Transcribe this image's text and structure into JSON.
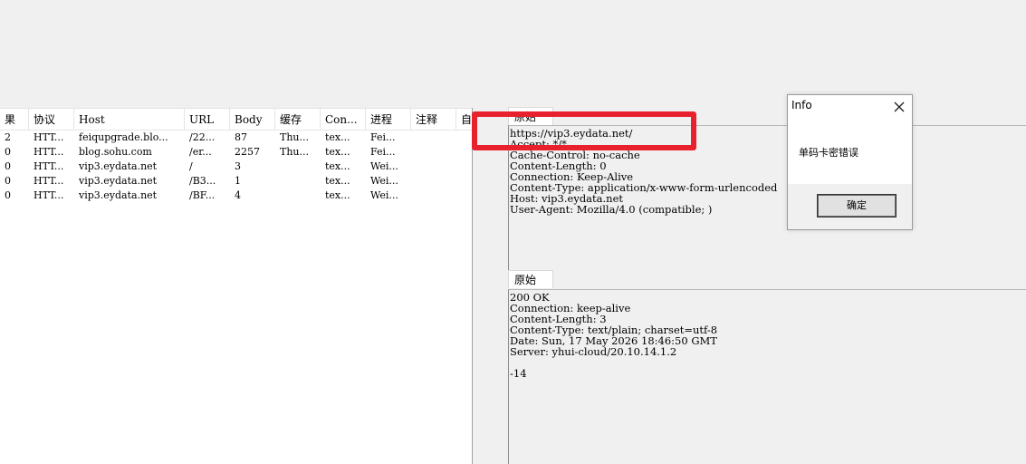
{
  "session_list": {
    "columns": [
      "果",
      "协议",
      "Host",
      "URL",
      "Body",
      "缓存",
      "Con...",
      "进程",
      "注释",
      "自"
    ],
    "rows": [
      [
        "2",
        "HTT...",
        "feiqupgrade.blo...",
        "/22...",
        "87",
        "Thu...",
        "tex...",
        "Fei..."
      ],
      [
        "0",
        "HTT...",
        "blog.sohu.com",
        "/er...",
        "2257",
        "Thu...",
        "tex...",
        "Fei..."
      ],
      [
        "0",
        "HTT...",
        "vip3.eydata.net",
        "/",
        "3",
        "",
        "tex...",
        "Wei..."
      ],
      [
        "0",
        "HTT...",
        "vip3.eydata.net",
        "/B3...",
        "1",
        "",
        "tex...",
        "Wei..."
      ],
      [
        "0",
        "HTT...",
        "vip3.eydata.net",
        "/BF...",
        "4",
        "",
        "tex...",
        "Wei..."
      ]
    ]
  },
  "request_pane": {
    "tab_label": "原始",
    "lines": [
      "https://vip3.eydata.net/",
      "Accept: */*",
      "Cache-Control: no-cache",
      "Content-Length: 0",
      "Connection: Keep-Alive",
      "Content-Type: application/x-www-form-urlencoded",
      "Host: vip3.eydata.net",
      "User-Agent: Mozilla/4.0 (compatible; )"
    ]
  },
  "response_pane": {
    "tab_label": "原始",
    "lines": [
      "200 OK",
      "Connection: keep-alive",
      "Content-Length: 3",
      "Content-Type: text/plain; charset=utf-8",
      "Date: Sun, 17 May 2026 18:46:50 GMT",
      "Server: yhui-cloud/20.10.14.1.2",
      "",
      "-14"
    ]
  },
  "dialog": {
    "title": "Info",
    "message": "单码卡密错误",
    "ok_label": "确定"
  },
  "colors": {
    "highlight": "#e8222c"
  }
}
